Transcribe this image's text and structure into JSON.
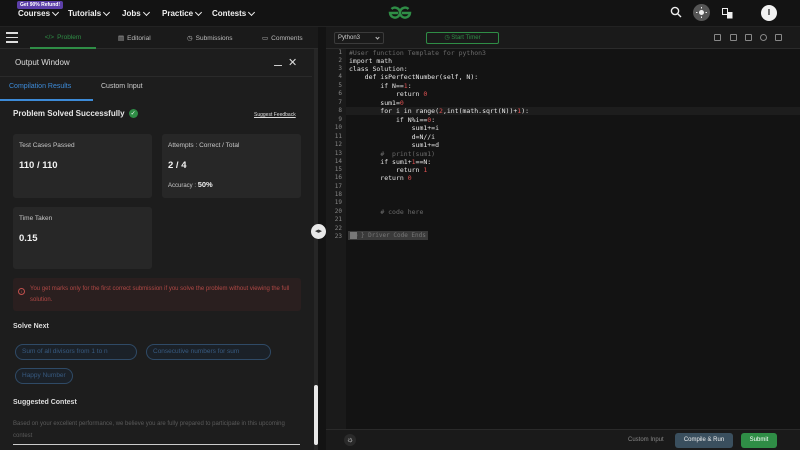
{
  "topnav": {
    "badge": "Get 90% Refund!",
    "items": [
      {
        "label": "Courses"
      },
      {
        "label": "Tutorials"
      },
      {
        "label": "Jobs"
      },
      {
        "label": "Practice"
      },
      {
        "label": "Contests"
      }
    ],
    "avatar_letter": "I",
    "brand_color": "#2f8d46"
  },
  "problem_tabs": [
    {
      "label": "Problem",
      "icon": "code-icon",
      "active": true
    },
    {
      "label": "Editorial",
      "icon": "document-icon",
      "active": false
    },
    {
      "label": "Submissions",
      "icon": "clock-icon",
      "active": false
    },
    {
      "label": "Comments",
      "icon": "comment-icon",
      "active": false
    }
  ],
  "output": {
    "title": "Output Window",
    "tabs": [
      {
        "label": "Compilation Results",
        "active": true
      },
      {
        "label": "Custom Input",
        "active": false
      }
    ],
    "status": "Problem Solved Successfully",
    "feedback_link": "Suggest Feedback",
    "test_cases": {
      "label": "Test Cases Passed",
      "value": "110 / 110"
    },
    "attempts": {
      "label": "Attempts : Correct / Total",
      "value": "2 / 4",
      "accuracy_label": "Accuracy :",
      "accuracy_value": "50%"
    },
    "time_taken": {
      "label": "Time Taken",
      "value": "0.15"
    },
    "warning": "You get marks only for the first correct submission if you solve the problem without viewing the full solution.",
    "solve_next_title": "Solve Next",
    "solve_next": [
      "Sum of all divisors from 1 to n",
      "Consecutive numbers for sum",
      "Happy Number"
    ],
    "contest_title": "Suggested Contest",
    "contest_text": "Based on your excellent performance, we believe you are fully prepared to participate in this upcoming contest"
  },
  "editor": {
    "language": "Python3",
    "timer_label": "Start Timer",
    "driver_code": "} Driver Code Ends"
  },
  "bottom": {
    "custom_input": "Custom Input",
    "compile_run": "Compile & Run",
    "submit": "Submit"
  }
}
